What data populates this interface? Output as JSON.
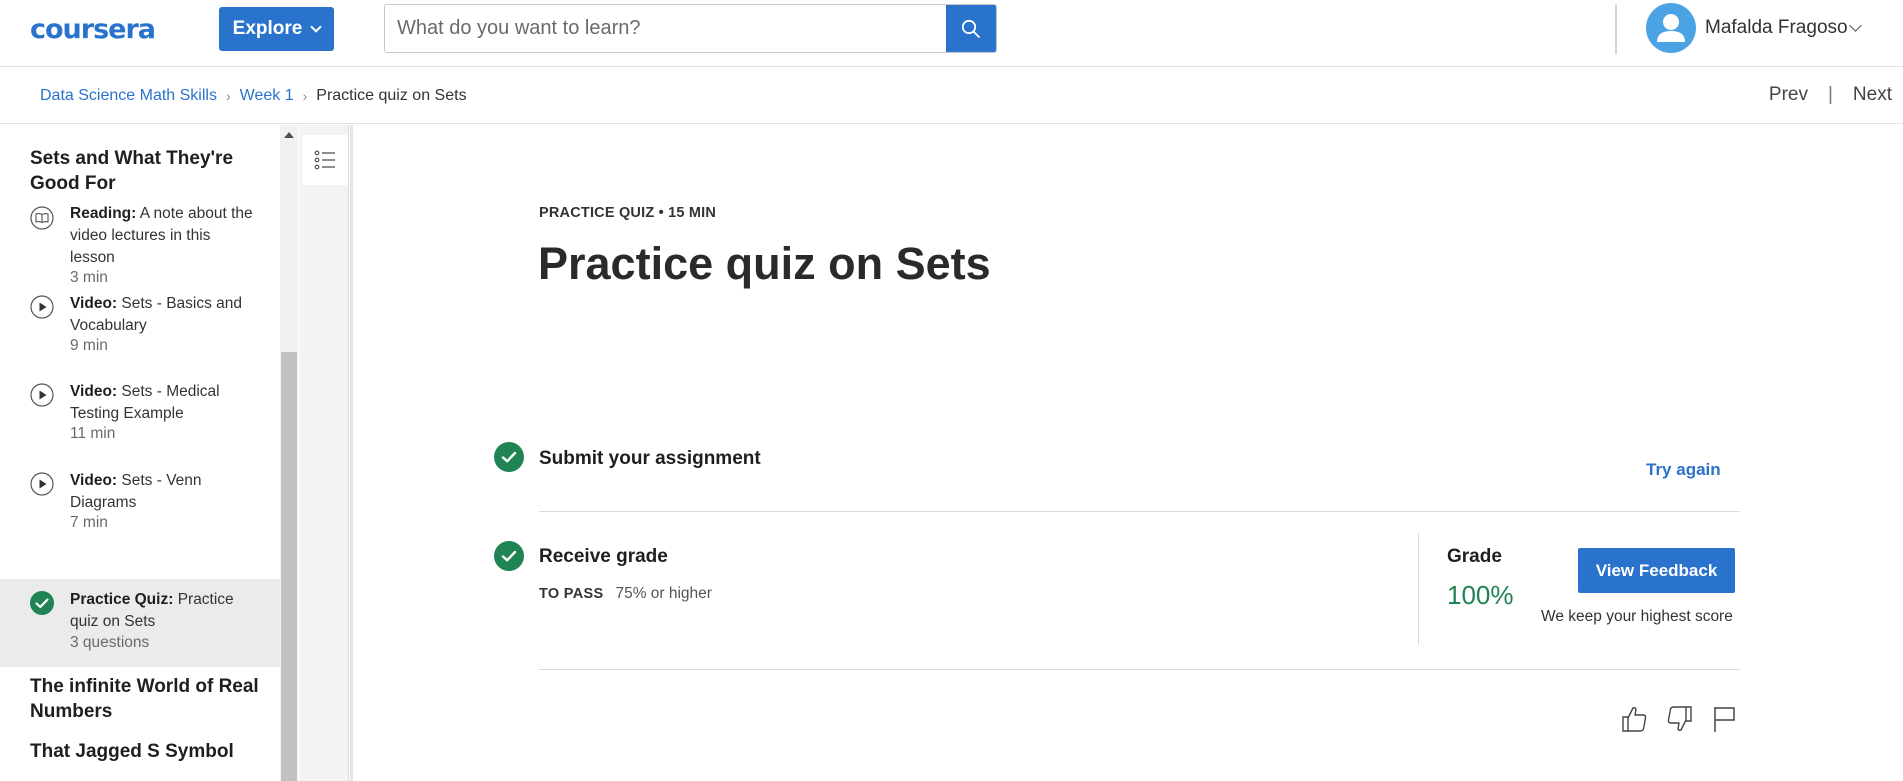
{
  "header": {
    "logo": "coursera",
    "explore_label": "Explore",
    "search_placeholder": "What do you want to learn?",
    "user_name": "Mafalda Fragoso"
  },
  "breadcrumb": {
    "items": [
      "Data Science Math Skills",
      "Week 1"
    ],
    "current": "Practice quiz on Sets"
  },
  "nav": {
    "prev": "Prev",
    "separator": "|",
    "next": "Next"
  },
  "sidebar": {
    "section_1": "Sets and What They're Good For",
    "items": [
      {
        "type": "Reading:",
        "title": "A note about the video lectures in this lesson",
        "meta": "3 min",
        "icon": "book-icon"
      },
      {
        "type": "Video:",
        "title": "Sets - Basics and Vocabulary",
        "meta": "9 min",
        "icon": "play-icon"
      },
      {
        "type": "Video:",
        "title": "Sets - Medical Testing Example",
        "meta": "11 min",
        "icon": "play-icon"
      },
      {
        "type": "Video:",
        "title": "Sets - Venn Diagrams",
        "meta": "7 min",
        "icon": "play-icon"
      },
      {
        "type": "Practice Quiz:",
        "title": "Practice quiz on Sets",
        "meta": "3 questions",
        "icon": "check-circle-icon",
        "active": true
      }
    ],
    "section_2": "The infinite World of Real Numbers",
    "section_3": "That Jagged S Symbol"
  },
  "main": {
    "kicker": "PRACTICE QUIZ • 15 MIN",
    "title": "Practice quiz on Sets",
    "step_1": "Submit your assignment",
    "try_again": "Try again",
    "step_2": "Receive grade",
    "to_pass_label": "TO PASS",
    "to_pass_value": "75% or higher",
    "grade_label": "Grade",
    "grade_value": "100%",
    "view_feedback": "View Feedback",
    "highest_note": "We keep your highest score"
  },
  "colors": {
    "brand_blue": "#2a73cc",
    "success_green": "#1f8354"
  }
}
